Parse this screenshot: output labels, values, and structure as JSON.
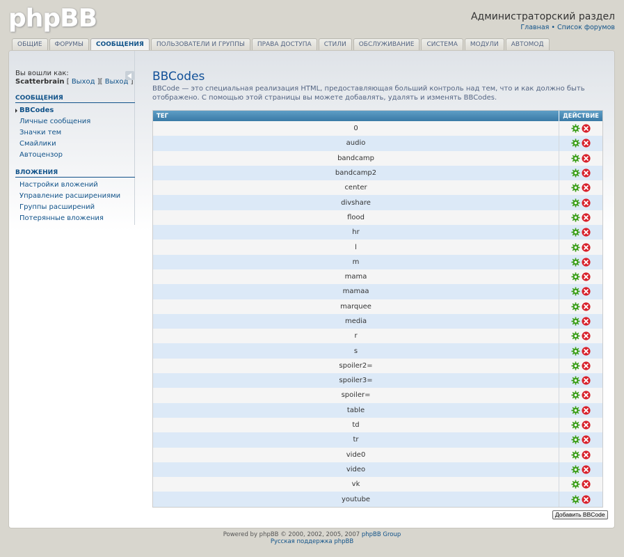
{
  "header": {
    "logo": "phpBB",
    "title": "Администраторский раздел",
    "links": [
      "Главная",
      "Список форумов"
    ],
    "link_separator": "•"
  },
  "tabs": [
    {
      "label": "Общие",
      "active": false
    },
    {
      "label": "Форумы",
      "active": false
    },
    {
      "label": "Сообщения",
      "active": true
    },
    {
      "label": "Пользователи и группы",
      "active": false
    },
    {
      "label": "Права доступа",
      "active": false
    },
    {
      "label": "Стили",
      "active": false
    },
    {
      "label": "Обслуживание",
      "active": false
    },
    {
      "label": "Система",
      "active": false
    },
    {
      "label": "Модули",
      "active": false
    },
    {
      "label": "Автомод",
      "active": false
    }
  ],
  "sidebar": {
    "login_label": "Вы вошли как:",
    "username": "Scatterbrain",
    "logout_1": "Выход",
    "logout_2": "Выход",
    "sections": [
      {
        "title": "Сообщения",
        "items": [
          {
            "label": "BBCodes",
            "active": true
          },
          {
            "label": "Личные сообщения",
            "active": false
          },
          {
            "label": "Значки тем",
            "active": false
          },
          {
            "label": "Смайлики",
            "active": false
          },
          {
            "label": "Автоцензор",
            "active": false
          }
        ]
      },
      {
        "title": "Вложения",
        "items": [
          {
            "label": "Настройки вложений",
            "active": false
          },
          {
            "label": "Управление расширениями",
            "active": false
          },
          {
            "label": "Группы расширений",
            "active": false
          },
          {
            "label": "Потерянные вложения",
            "active": false
          }
        ]
      }
    ]
  },
  "main": {
    "title": "BBCodes",
    "description": "BBCode — это специальная реализация HTML, предоставляющая больший контроль над тем, что и как должно быть отображено. С помощью этой страницы вы можете добавлять, удалять и изменять BBCodes.",
    "table": {
      "col_tag": "Тег",
      "col_action": "Действие",
      "rows": [
        "0",
        "audio",
        "bandcamp",
        "bandcamp2",
        "center",
        "divshare",
        "flood",
        "hr",
        "l",
        "m",
        "mama",
        "mamaa",
        "marquee",
        "media",
        "r",
        "s",
        "spoiler2=",
        "spoiler3=",
        "spoiler=",
        "table",
        "td",
        "tr",
        "vide0",
        "video",
        "vk",
        "youtube"
      ]
    },
    "add_button": "Добавить BBCode"
  },
  "footer": {
    "powered_prefix": "Powered by phpBB © 2000, 2002, 2005, 2007 ",
    "powered_link": "phpBB Group",
    "support_link": "Русская поддержка phpBB"
  },
  "colors": {
    "accent": "#105289",
    "header_row": "#4a8ab8",
    "row_odd": "#f5f5f5",
    "row_even": "#dce9f7",
    "edit_icon": "#3c9e1a",
    "delete_icon": "#d8212b"
  },
  "icons": {
    "edit": "gear-icon",
    "delete": "delete-icon"
  }
}
